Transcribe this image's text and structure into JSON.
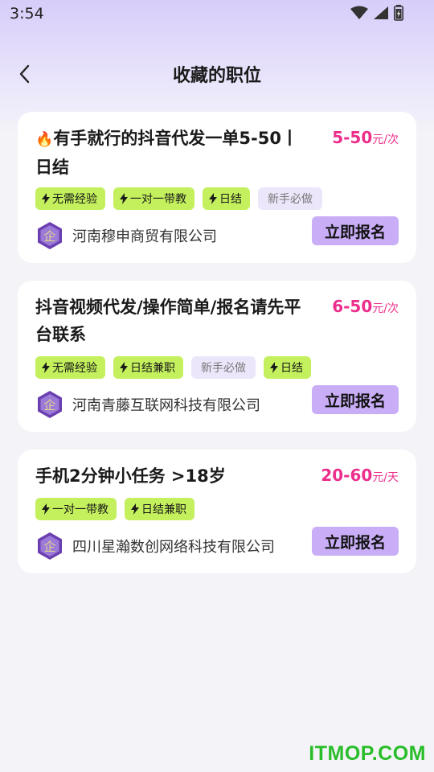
{
  "status_bar": {
    "time": "3:54"
  },
  "header": {
    "title": "收藏的职位"
  },
  "jobs": [
    {
      "title": "有手就行的抖音代发一单5-50丨日结",
      "salary": "5-50",
      "salary_unit": "元/次",
      "tags": [
        {
          "label": "无需经验",
          "style": "green"
        },
        {
          "label": "一对一带教",
          "style": "green"
        },
        {
          "label": "日结",
          "style": "green"
        },
        {
          "label": "新手必做",
          "style": "purple"
        }
      ],
      "company": "河南穆申商贸有限公司",
      "apply_label": "立即报名"
    },
    {
      "title": "抖音视频代发/操作简单/报名请先平台联系",
      "salary": "6-50",
      "salary_unit": "元/次",
      "tags": [
        {
          "label": "无需经验",
          "style": "green"
        },
        {
          "label": "日结兼职",
          "style": "green"
        },
        {
          "label": "新手必做",
          "style": "purple"
        },
        {
          "label": "日结",
          "style": "green"
        }
      ],
      "company": "河南青藤互联网科技有限公司",
      "apply_label": "立即报名"
    },
    {
      "title": "手机2分钟小任务 >18岁",
      "salary": "20-60",
      "salary_unit": "元/天",
      "tags": [
        {
          "label": "一对一带教",
          "style": "green"
        },
        {
          "label": "日结兼职",
          "style": "green"
        }
      ],
      "company": "四川星瀚数创网络科技有限公司",
      "apply_label": "立即报名"
    }
  ],
  "company_logo_char": "企",
  "watermark": "ITMOP.COM",
  "colors": {
    "salary": "#ec2f8c",
    "tag_green": "#c3f05c",
    "tag_purple": "#ece6fb",
    "apply_button": "#c9aef7"
  }
}
